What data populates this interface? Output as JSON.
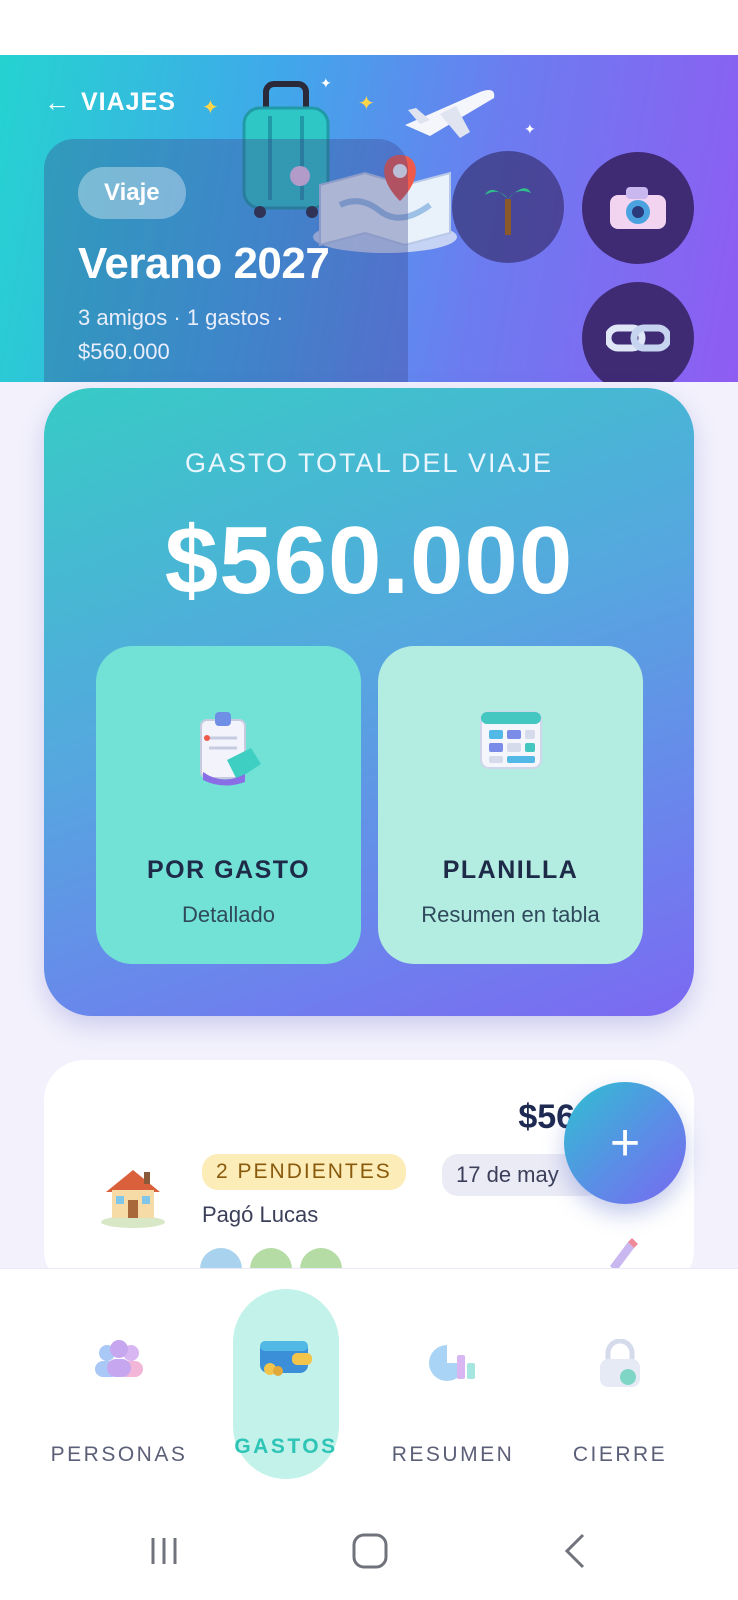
{
  "header": {
    "back_label": "VIAJES",
    "tag": "Viaje",
    "title": "Verano 2027",
    "meta": "3 amigos · 1 gastos · $560.000"
  },
  "total": {
    "label": "GASTO TOTAL DEL VIAJE",
    "amount": "$560.000"
  },
  "views": [
    {
      "title": "POR GASTO",
      "subtitle": "Detallado",
      "icon": "receipt-tag-icon"
    },
    {
      "title": "PLANILLA",
      "subtitle": "Resumen en tabla",
      "icon": "spreadsheet-icon"
    }
  ],
  "expense": {
    "amount": "$560",
    "status": "2 PENDIENTES",
    "date": "17 de may",
    "payer": "Pagó Lucas",
    "icon": "house-icon"
  },
  "fab": {
    "label": "+"
  },
  "nav": {
    "items": [
      {
        "label": "PERSONAS",
        "icon": "people-icon"
      },
      {
        "label": "GASTOS",
        "icon": "wallet-icon",
        "active": true
      },
      {
        "label": "RESUMEN",
        "icon": "chart-icon"
      },
      {
        "label": "CIERRE",
        "icon": "lock-icon"
      }
    ]
  },
  "colors": {
    "accent_teal": "#2ec4b6",
    "accent_purple": "#7c68f2",
    "text_dark": "#1e2a52",
    "badge_pending_bg": "#fbecb8"
  }
}
